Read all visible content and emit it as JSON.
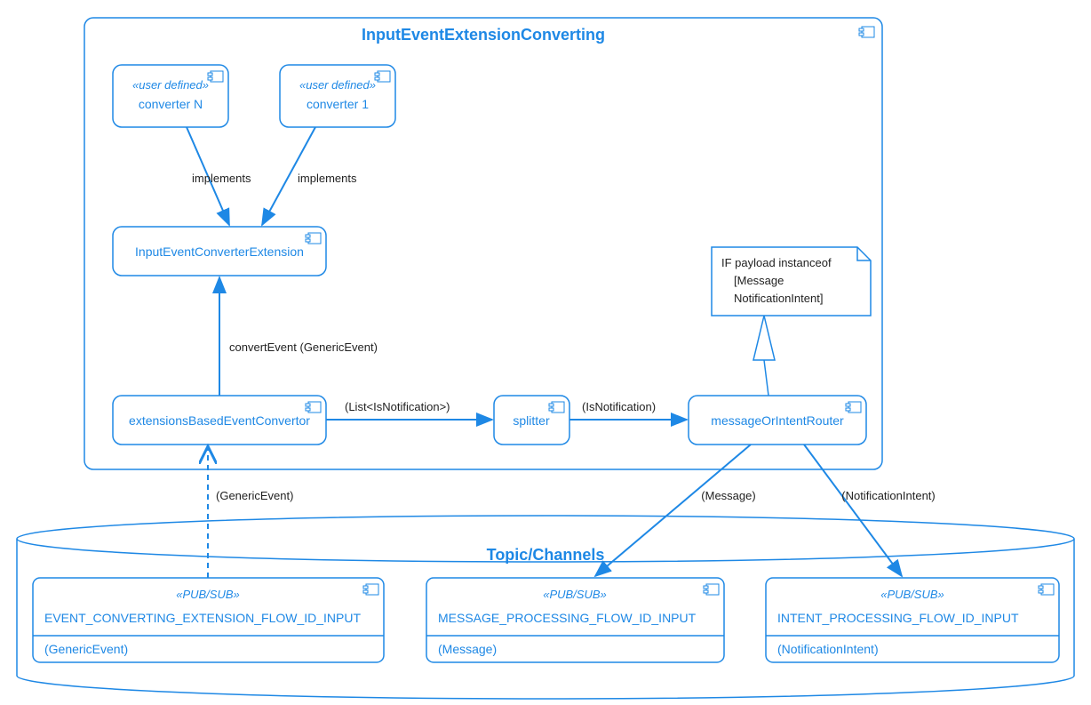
{
  "package": {
    "title": "InputEventExtensionConverting"
  },
  "components": {
    "converterN": {
      "stereotype": "«user defined»",
      "name": "converter N"
    },
    "converter1": {
      "stereotype": "«user defined»",
      "name": "converter 1"
    },
    "extensionIface": {
      "name": "InputEventConverterExtension"
    },
    "eventConvertor": {
      "name": "extensionsBasedEventConvertor"
    },
    "splitter": {
      "name": "splitter"
    },
    "router": {
      "name": "messageOrIntentRouter"
    }
  },
  "note": {
    "line1": "IF payload instanceof",
    "line2": "[Message",
    "line3": "NotificationIntent]"
  },
  "edges": {
    "implements1": "implements",
    "implements2": "implements",
    "convertEvent": "convertEvent (GenericEvent)",
    "listNotif": "(List<IsNotification>)",
    "isNotif": "(IsNotification)",
    "genericEvent": "(GenericEvent)",
    "message": "(Message)",
    "notifIntent": "(NotificationIntent)"
  },
  "channels": {
    "title": "Topic/Channels",
    "ch1": {
      "stereotype": "«PUB/SUB»",
      "name": "EVENT_CONVERTING_EXTENSION_FLOW_ID_INPUT",
      "payload": "(GenericEvent)"
    },
    "ch2": {
      "stereotype": "«PUB/SUB»",
      "name": "MESSAGE_PROCESSING_FLOW_ID_INPUT",
      "payload": "(Message)"
    },
    "ch3": {
      "stereotype": "«PUB/SUB»",
      "name": "INTENT_PROCESSING_FLOW_ID_INPUT",
      "payload": "(NotificationIntent)"
    }
  }
}
